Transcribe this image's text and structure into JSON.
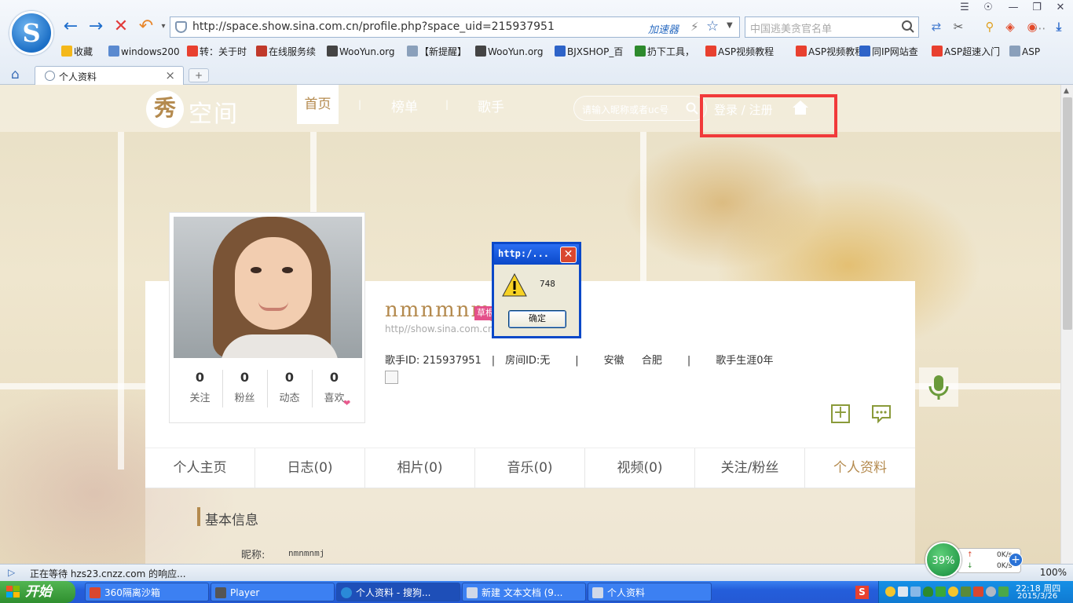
{
  "browser": {
    "logo": "S",
    "url": "http://space.show.sina.com.cn/profile.php?space_uid=215937951",
    "accelerator_label": "加速器",
    "search_placeholder": "中国逃美贪官名单",
    "icons": [
      "back-icon",
      "forward-icon",
      "stop-icon",
      "undo-icon",
      "star-icon",
      "search-icon"
    ],
    "bookmarks": [
      {
        "label": "收藏",
        "icon": "star-icon",
        "color": "#f4b81a"
      },
      {
        "label": "windows200",
        "icon": "link-icon",
        "color": "#5a8ad0"
      },
      {
        "label": "转：关于时",
        "icon": "weibo-icon",
        "color": "#e8402f"
      },
      {
        "label": "在线服务续",
        "icon": "pen-icon",
        "color": "#c0392b"
      },
      {
        "label": "WooYun.org",
        "icon": "wooyun-icon",
        "color": "#444"
      },
      {
        "label": "【新提醒】",
        "icon": "page-icon",
        "color": "#8aa0bb"
      },
      {
        "label": "WooYun.org",
        "icon": "wooyun-icon",
        "color": "#444"
      },
      {
        "label": "BJXSHOP_百",
        "icon": "paw-icon",
        "color": "#2d63c8"
      },
      {
        "label": "扔下工具，",
        "icon": "ps-icon",
        "color": "#2d8a2d"
      },
      {
        "label": "ASP视频教程",
        "icon": "weibo-icon",
        "color": "#e8402f"
      },
      {
        "label": "ASP视频教程",
        "icon": "weibo-icon",
        "color": "#e8402f"
      },
      {
        "label": "同IP网站查",
        "icon": "flag-icon",
        "color": "#2d63c8"
      },
      {
        "label": "ASP超速入门",
        "icon": "weibo-icon",
        "color": "#e8402f"
      },
      {
        "label": "ASP",
        "icon": "page-icon",
        "color": "#8aa0bb"
      }
    ],
    "tab_title": "个人资料",
    "new_tab": "+",
    "status_text": "正在等待 hzs23.cnzz.com 的响应...",
    "zoom": "100%"
  },
  "site": {
    "logo_char": "秀",
    "logo_text": "空间",
    "nav": [
      "首页",
      "榜单",
      "歌手"
    ],
    "nav_sep": "|",
    "search_placeholder": "请输入昵称或者uc号",
    "login": "登录 / 注册"
  },
  "profile": {
    "username": "nmnmnmj",
    "badge": "草根",
    "url": "http//show.sina.com.cn/2",
    "stats": [
      {
        "value": "0",
        "label": "关注"
      },
      {
        "value": "0",
        "label": "粉丝"
      },
      {
        "value": "0",
        "label": "动态"
      },
      {
        "value": "0",
        "label": "喜欢"
      }
    ],
    "info": {
      "singer_id": "歌手ID: 215937951",
      "room_id": "房间ID:无",
      "province": "安徽",
      "city": "合肥",
      "career": "歌手生涯0年",
      "sep": "|"
    },
    "tabs": [
      "个人主页",
      "日志(0)",
      "相片(0)",
      "音乐(0)",
      "视频(0)",
      "关注/粉丝",
      "个人资料"
    ],
    "active_tab": 6,
    "section_title": "基本信息",
    "nick_label": "昵称:",
    "nick_value": "nmnmnmj"
  },
  "dialog": {
    "title": "http:/...",
    "message": "748",
    "ok": "确定"
  },
  "speed": {
    "percent": "39%",
    "up": "0K/s",
    "down": "0K/s"
  },
  "taskbar": {
    "start": "开始",
    "tasks": [
      {
        "label": "360隔离沙箱",
        "color": "#d9472f"
      },
      {
        "label": "Player",
        "color": "#555"
      },
      {
        "label": "个人资料 - 搜狗...",
        "color": "#2a8ad8"
      },
      {
        "label": "新建 文本文档 (9...",
        "color": "#d0d8e8"
      },
      {
        "label": "个人资料",
        "color": "#d0d8e8"
      }
    ],
    "time": "22:18 周四",
    "date": "2015/3/26"
  },
  "colors": {
    "accent": "#b48a4e",
    "highlight_box": "#f13a3a",
    "badge": "#e4508a"
  }
}
